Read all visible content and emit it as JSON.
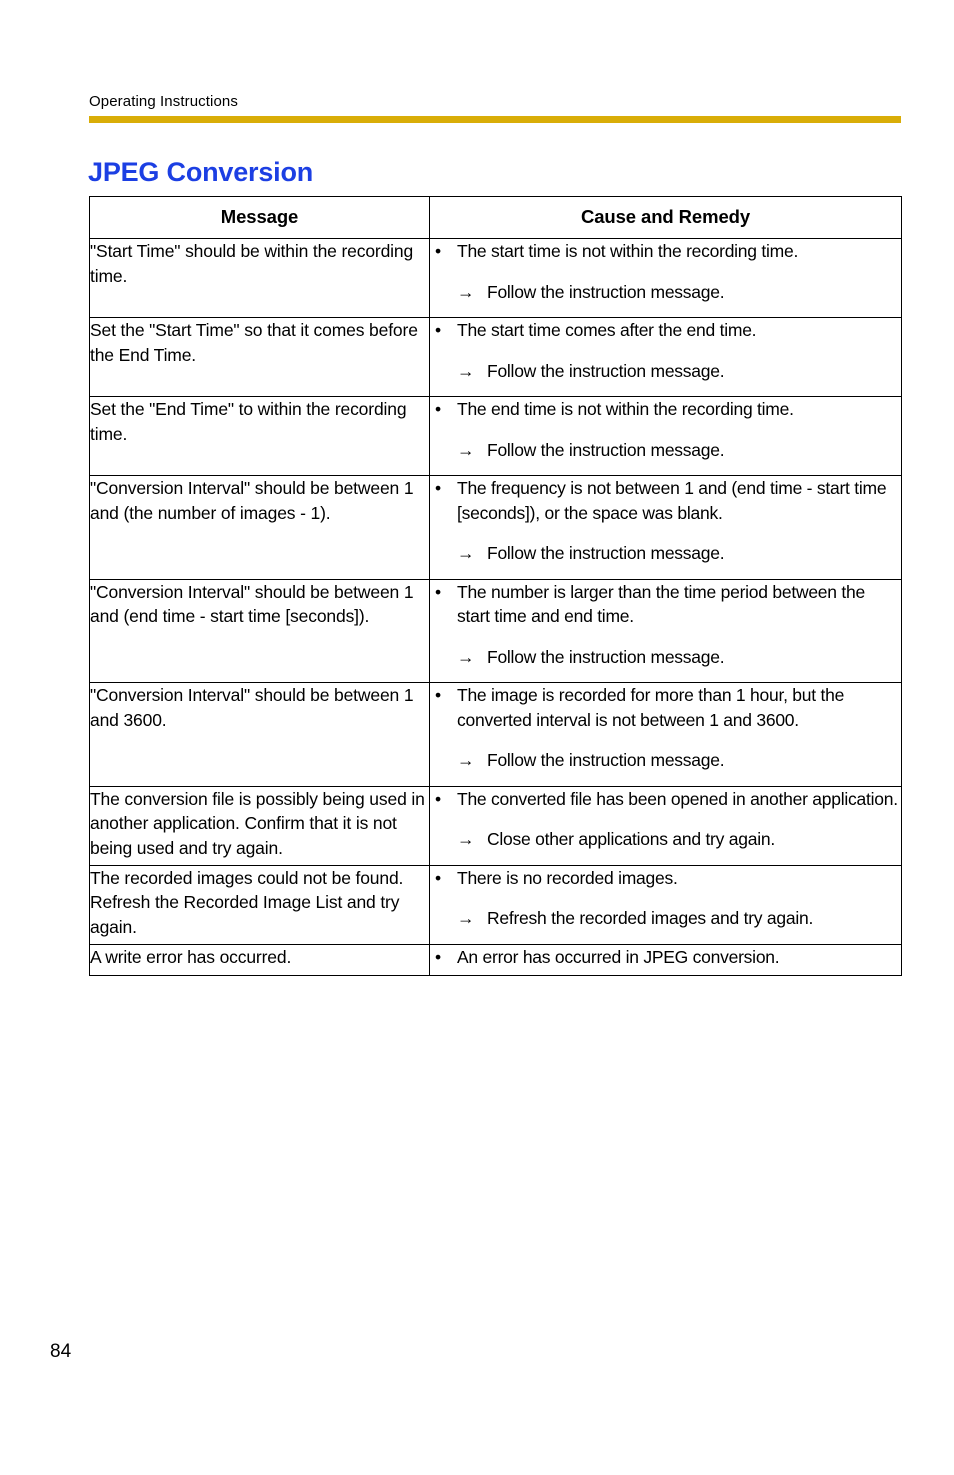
{
  "page": {
    "running_head": "Operating Instructions",
    "section_title": "JPEG Conversion",
    "folio": "84",
    "rule_color": "#D9AD07",
    "title_color": "#1C3FE3",
    "bullet_glyph": "•",
    "arrow_glyph": "→"
  },
  "table": {
    "headers": {
      "message": "Message",
      "cause": "Cause and Remedy"
    },
    "rows": [
      {
        "message": "\"Start Time\" should be within the recording time.",
        "cause": "The start time is not within the recording time.",
        "remedy": "Follow the instruction message."
      },
      {
        "message": "Set the \"Start Time\" so that it comes before the End Time.",
        "cause": "The start time comes after the end time.",
        "remedy": "Follow the instruction message."
      },
      {
        "message": "Set the \"End Time\" to within the recording time.",
        "cause": "The end time is not within the recording time.",
        "remedy": "Follow the instruction message."
      },
      {
        "message": "\"Conversion Interval\" should be between 1 and (the number of images - 1).",
        "cause": "The frequency is not between 1 and (end time - start time [seconds]), or the space was blank.",
        "remedy": "Follow the instruction message."
      },
      {
        "message": "\"Conversion Interval\" should be between 1 and (end time - start time [seconds]).",
        "cause": "The number is larger than the time period between the start time and end time.",
        "remedy": "Follow the instruction message."
      },
      {
        "message": "\"Conversion Interval\" should be between 1 and 3600.",
        "cause": "The image is recorded for more than 1 hour, but the converted interval is not between 1 and 3600.",
        "remedy": "Follow the instruction message."
      },
      {
        "message": "The conversion file is possibly being used in another application. Confirm that it is not being used and try again.",
        "cause": "The converted file has been opened in another application.",
        "remedy": "Close other applications and try again."
      },
      {
        "message": "The recorded images could not be found. Refresh the Recorded Image List and try again.",
        "cause": "There is no recorded images.",
        "remedy": "Refresh the recorded images and try again."
      },
      {
        "message": "A write error has occurred.",
        "cause": "An error has occurred in JPEG conversion.",
        "remedy": null
      }
    ]
  }
}
